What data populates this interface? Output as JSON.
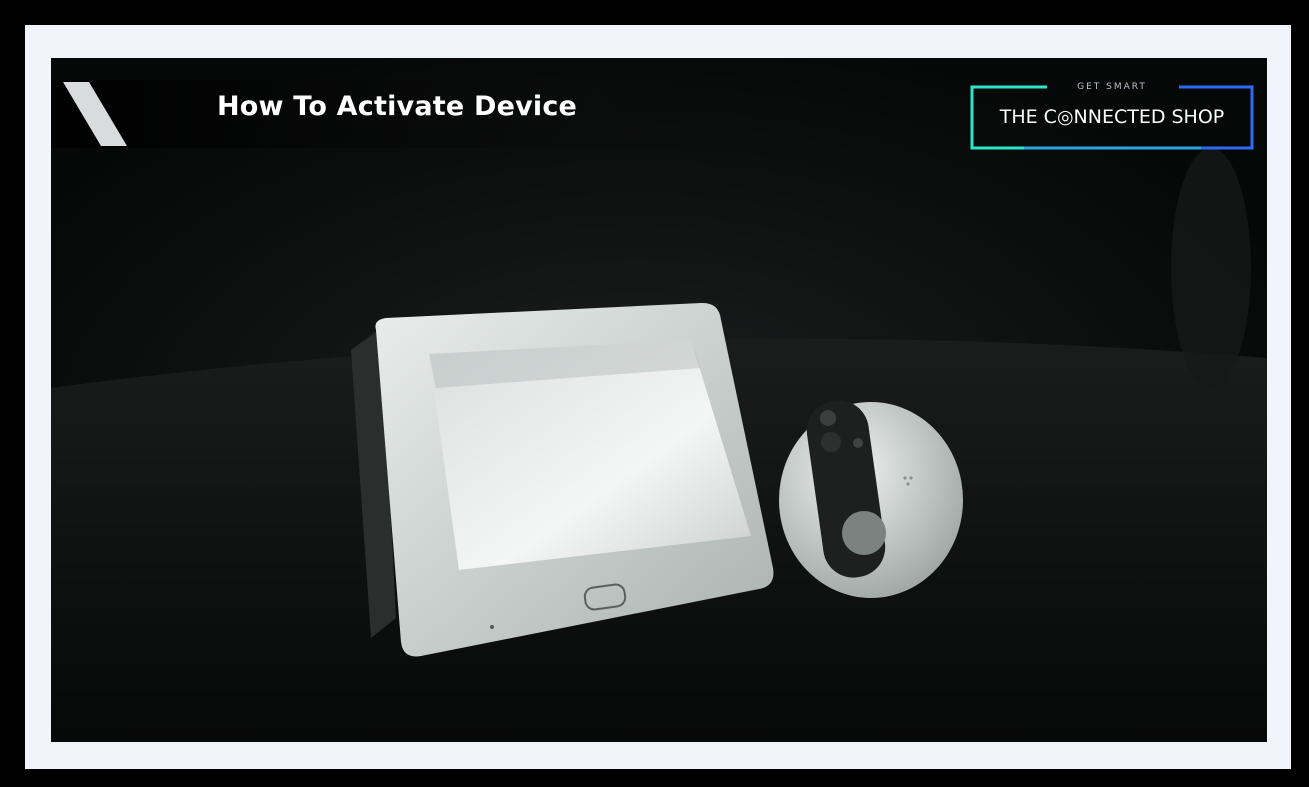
{
  "video": {
    "title": "How To Activate Device"
  },
  "logo": {
    "tagline": "GET SMART",
    "name": "THE C◎NNECTED SHOP"
  },
  "colors": {
    "frame_outer": "#000000",
    "frame_inner": "#f2f4fb",
    "logo_accent_teal": "#27e6c9",
    "logo_accent_blue": "#2a6cf2"
  },
  "icons": {
    "banner_slash": "slash-stripe-icon"
  }
}
